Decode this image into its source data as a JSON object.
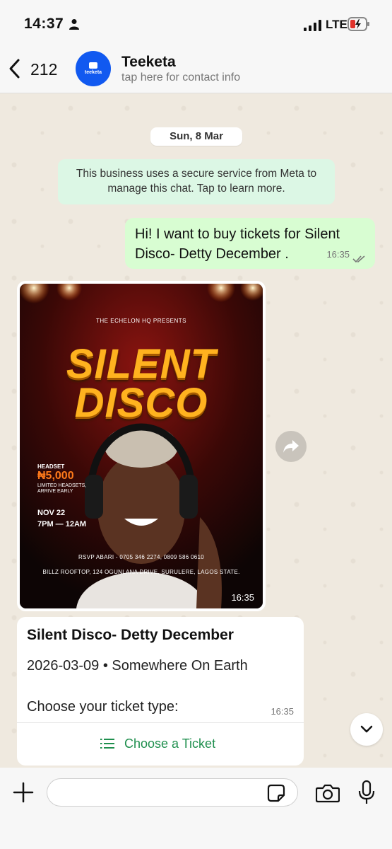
{
  "status_bar": {
    "time": "14:37",
    "network": "LTE"
  },
  "header": {
    "back_count": "212",
    "contact_name": "Teeketa",
    "contact_subtitle": "tap here for contact info",
    "avatar_text": "teeketa"
  },
  "chat": {
    "date_label": "Sun, 8 Mar",
    "security_notice": "This business uses a secure service from Meta to manage this chat. Tap to learn more.",
    "outgoing_message": {
      "text": "Hi! I want to buy tickets for Silent Disco- Detty December .",
      "time": "16:35"
    },
    "image_message": {
      "time": "16:35",
      "poster": {
        "presents": "THE ECHELON HQ PRESENTS",
        "title_line1": "SILENT",
        "title_line2": "DISCO",
        "headset_label": "HEADSET",
        "price": "₦5,000",
        "limited_note": "LIMITED HEADSETS, ARRIVE EARLY",
        "date": "NOV 22",
        "hours": "7PM — 12AM",
        "rsvp": "RSVP ABARI - 0705 346 2274, 0809 586 0610",
        "address": "BILLZ ROOFTOP, 124 OGUNLANA DRIVE, SURULERE, LAGOS STATE."
      }
    },
    "event_card": {
      "title": "Silent Disco- Detty December",
      "meta": "2026-03-09 • Somewhere On Earth",
      "prompt": "Choose your ticket type:",
      "time": "16:35",
      "action_label": "Choose a Ticket"
    }
  },
  "input_bar": {
    "placeholder": ""
  },
  "colors": {
    "outgoing_bubble": "#d8fdd2",
    "notice_bubble": "#dcf7e5",
    "action_green": "#1f8f4e",
    "avatar_blue": "#1159f0",
    "poster_title": "#ffb21f",
    "poster_price": "#ff7a1a"
  },
  "icons": [
    "person-icon",
    "signal-icon",
    "battery-charging-icon",
    "back-chevron-icon",
    "forward-icon",
    "list-icon",
    "chevron-down-icon",
    "plus-icon",
    "sticker-icon",
    "camera-icon",
    "mic-icon",
    "double-check-icon"
  ]
}
